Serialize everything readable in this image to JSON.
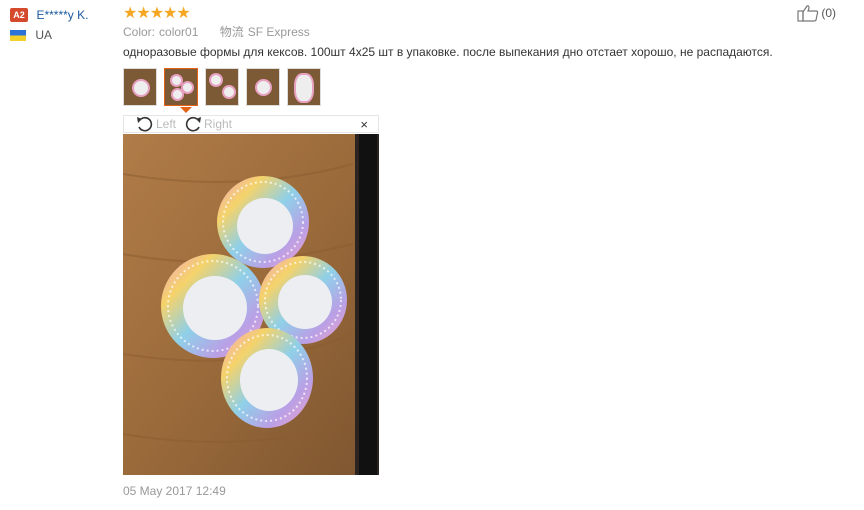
{
  "reviewer": {
    "level": "A2",
    "name": "E*****y K.",
    "country": "UA"
  },
  "rating": {
    "stars": 5,
    "display": "★★★★★"
  },
  "meta": {
    "color_label": "Color:",
    "color_value": "color01",
    "logistics_label": "物流",
    "logistics_value": "SF Express"
  },
  "helpful": {
    "count": "(0)"
  },
  "review_text": "одноразовые формы для кексов. 100шт 4x25 шт в упаковке. после выпекания дно отстает хорошо, не распадаются.",
  "thumbnails": {
    "count": 5,
    "active_index": 1
  },
  "viewer": {
    "rotate_left": "Left",
    "rotate_right": "Right",
    "close": "×"
  },
  "date": "05 May 2017 12:49",
  "colors": {
    "star": "#f5a623",
    "name_link": "#1c5aa0",
    "badge": "#d5492d",
    "active_thumb": "#e46218",
    "wood": "#9b6a3b"
  }
}
